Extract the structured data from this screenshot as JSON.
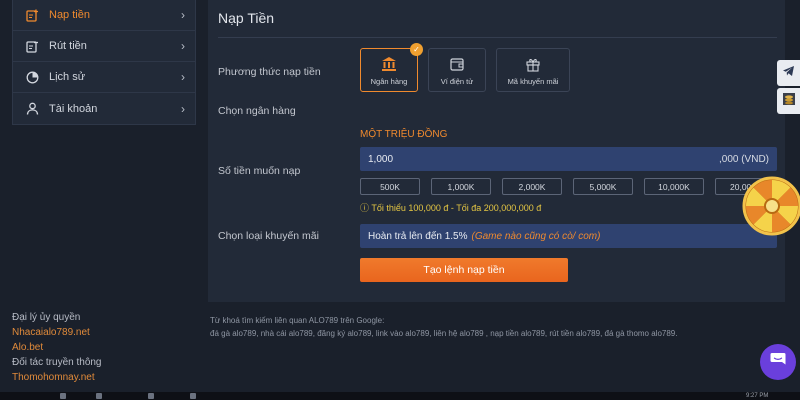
{
  "sidebar": {
    "items": [
      {
        "label": "Nạp tiền",
        "icon": "deposit-icon",
        "active": true
      },
      {
        "label": "Rút tiền",
        "icon": "withdraw-icon",
        "active": false
      },
      {
        "label": "Lịch sử",
        "icon": "history-icon",
        "active": false
      },
      {
        "label": "Tài khoản",
        "icon": "user-icon",
        "active": false
      }
    ]
  },
  "left_footer": {
    "agent_label": "Đại lý ủy quyền",
    "agent_link": "Nhacaialo789.net",
    "brand_link": "Alo.bet",
    "partner_label": "Đối tác truyền thông",
    "partner_link": "Thomohomnay.net"
  },
  "main": {
    "title": "Nạp Tiền",
    "method_label": "Phương thức nạp tiền",
    "methods": [
      {
        "label": "Ngân hàng",
        "icon": "bank-icon",
        "selected": true
      },
      {
        "label": "Ví điện tử",
        "icon": "wallet-icon",
        "selected": false
      },
      {
        "label": "Mã khuyến mãi",
        "icon": "gift-icon",
        "selected": false
      }
    ],
    "bank_label": "Chọn ngân hàng",
    "amount_label": "Số tiền muốn nạp",
    "amount_words": "MỘT TRIỆU ĐỒNG",
    "amount_value": "1,000",
    "amount_suffix": ",000 (VND)",
    "presets": [
      "500K",
      "1,000K",
      "2,000K",
      "5,000K",
      "10,000K",
      "20,00"
    ],
    "minmax": "ⓘ Tối thiểu 100,000 đ - Tối đa 200,000,000 đ",
    "promo_label": "Chọn loại khuyến mãi",
    "promo_value": "Hoàn trả lên đến 1.5%",
    "promo_hint": "(Game nào cũng có cò/ com)",
    "submit_label": "Tạo lệnh nạp tiền"
  },
  "keywords": {
    "heading": "Từ khoá tìm kiếm liên quan ALO789 trên Google:",
    "list": "đá gà alo789, nhà cái alo789, đăng ký alo789, link vào alo789, liên hệ alo789 , nạp tiền alo789, rút tiền alo789, đá gà thomo alo789."
  },
  "taskbar": {
    "time": "9:27 PM"
  },
  "colors": {
    "accent": "#f08a2e",
    "input_bg": "#2f4270",
    "panel_bg": "#222a38",
    "page_bg": "#1a202b"
  }
}
